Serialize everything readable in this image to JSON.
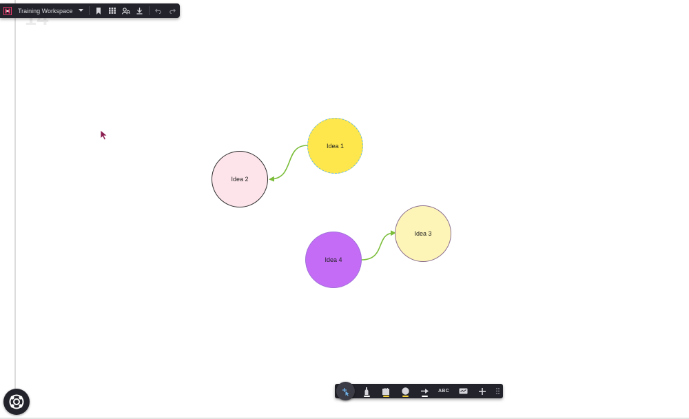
{
  "workspace": {
    "title": "Training Workspace"
  },
  "canvas": {
    "page_number": "14"
  },
  "nodes": [
    {
      "id": "idea-1",
      "label": "Idea 1",
      "fill": "#fde74c",
      "border": "#69b9d9"
    },
    {
      "id": "idea-2",
      "label": "Idea 2",
      "fill": "#fde4ea",
      "border": "#2b2b2b"
    },
    {
      "id": "idea-3",
      "label": "Idea 3",
      "fill": "#fdf5b8",
      "border": "#8c6f8c"
    },
    {
      "id": "idea-4",
      "label": "Idea 4",
      "fill": "#c46cf6",
      "border": "#a070d8"
    }
  ],
  "connectors": [
    {
      "from": "Idea 1",
      "to": "Idea 2",
      "color": "#7bbd3a"
    },
    {
      "from": "Idea 4",
      "to": "Idea 3",
      "color": "#7bbd3a"
    }
  ],
  "top_toolbar": {
    "icons": [
      "logo-icon",
      "chevron-down-icon",
      "bookmark-icon",
      "grid-icon",
      "search-people-icon",
      "download-icon",
      "undo-icon",
      "redo-icon"
    ]
  },
  "bottom_toolbar": {
    "text_tool_label": "ABC",
    "colors": {
      "marker_underline": "#ffffff",
      "sticky_underline": "#f5d33a",
      "shape_underline": "#f5d33a",
      "connector_underline": "#ffffff"
    },
    "icons": [
      "select-move-icon",
      "marker-icon",
      "sticky-note-icon",
      "shape-icon",
      "connector-arrow-icon",
      "text-icon",
      "comment-icon",
      "add-icon",
      "grip-icon"
    ]
  },
  "colors": {
    "toolbar_bg": "#23232b",
    "accent_logo": "#e53a6b",
    "cursor": "#8a1d4f"
  }
}
